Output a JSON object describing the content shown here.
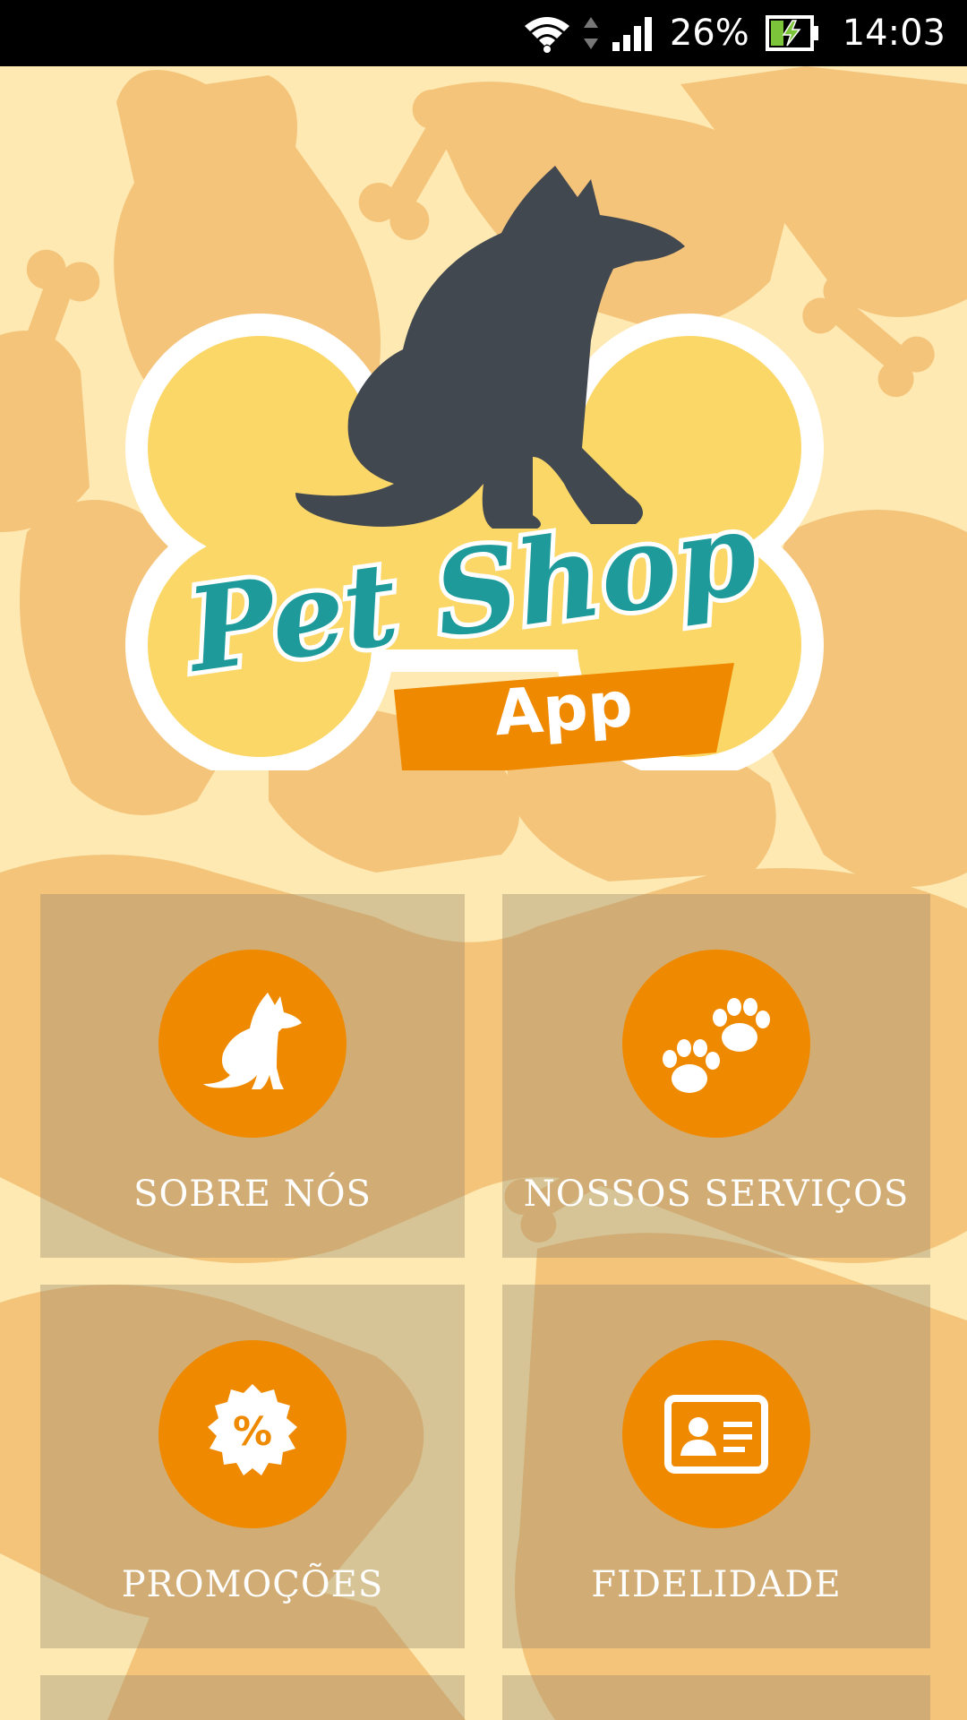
{
  "status_bar": {
    "battery_percent": "26%",
    "time": "14:03",
    "icons": [
      "wifi-icon",
      "data-arrows-icon",
      "signal-icon",
      "battery-charging-icon"
    ]
  },
  "logo": {
    "title": "Pet Shop",
    "subtitle": "App",
    "icon": "dog-on-bone-logo"
  },
  "menu": {
    "items": [
      {
        "label": "SOBRE NÓS",
        "icon": "dog-icon"
      },
      {
        "label": "NOSSOS SERVIÇOS",
        "icon": "paws-icon"
      },
      {
        "label": "PROMOÇÕES",
        "icon": "percent-badge-icon"
      },
      {
        "label": "FIDELIDADE",
        "icon": "id-card-icon"
      }
    ]
  },
  "colors": {
    "background": "#fde9b1",
    "pattern": "#f5c47b",
    "accent_orange": "#ef8a00",
    "logo_teal": "#1f9a9a",
    "logo_dog": "#424850",
    "bone_yellow": "#fbd768",
    "tile_overlay": "rgba(155,140,110,0.40)"
  }
}
